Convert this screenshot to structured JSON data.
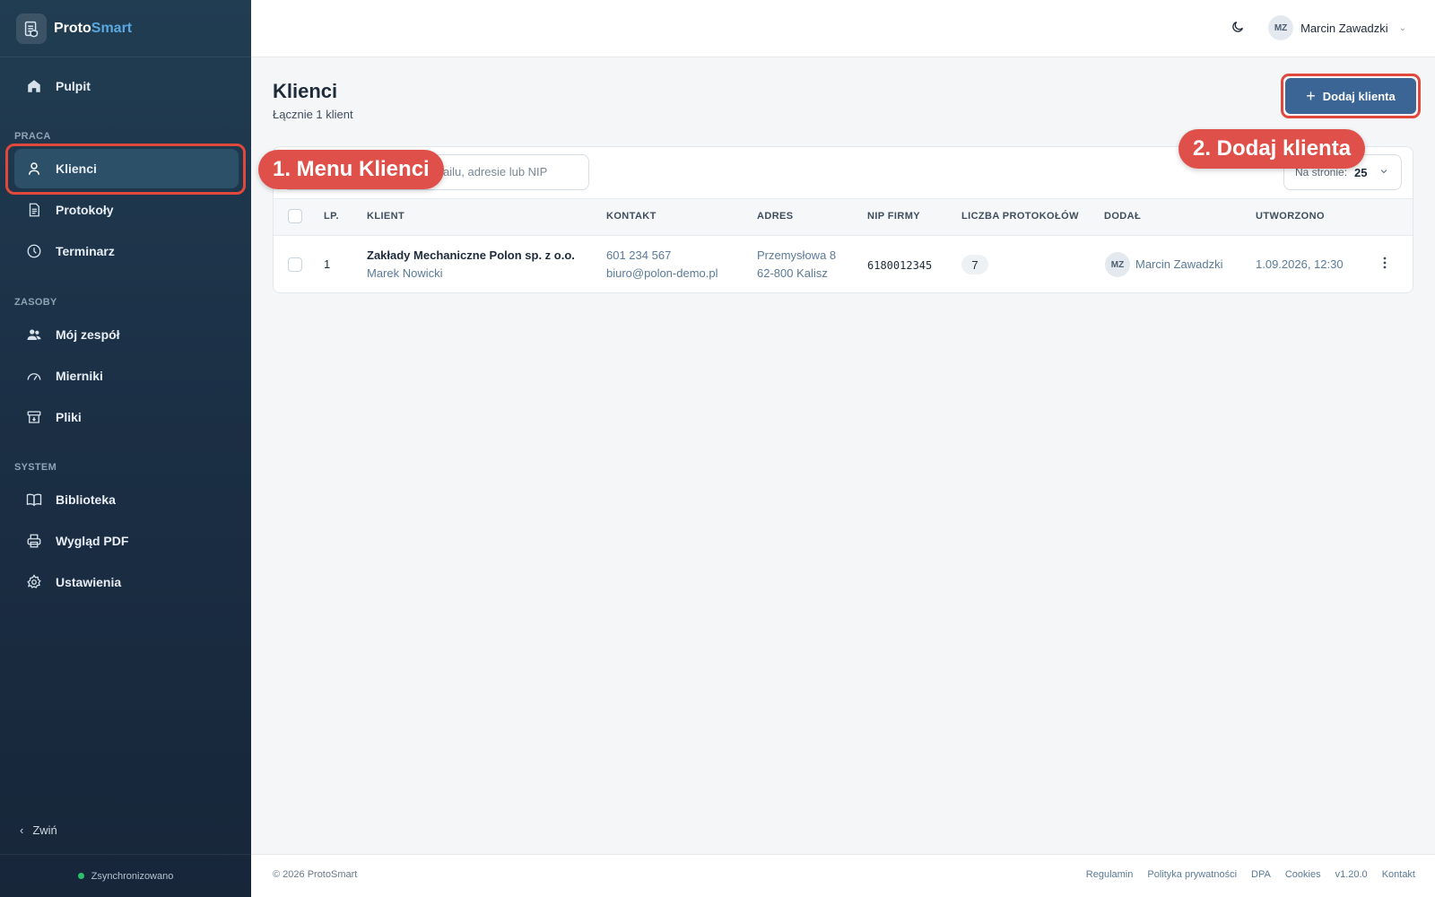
{
  "brand": {
    "name_a": "Proto",
    "name_b": "Smart"
  },
  "sidebar": {
    "dashboard": "Pulpit",
    "section_work": "PRACA",
    "clients": "Klienci",
    "protocols": "Protokoły",
    "schedule": "Terminarz",
    "section_resources": "ZASOBY",
    "team": "Mój zespół",
    "meters": "Mierniki",
    "files": "Pliki",
    "section_system": "SYSTEM",
    "library": "Biblioteka",
    "pdf_look": "Wygląd PDF",
    "settings": "Ustawienia",
    "collapse": "Zwiń",
    "sync_status": "Zsynchronizowano"
  },
  "topbar": {
    "user_initials": "MZ",
    "user_name": "Marcin Zawadzki"
  },
  "page": {
    "title": "Klienci",
    "subtitle": "Łącznie 1 klient",
    "add_button": "Dodaj klienta"
  },
  "search": {
    "visible_text": "ailu, adresie lub NIP"
  },
  "per_page": {
    "label": "Na stronie:",
    "value": "25"
  },
  "table": {
    "headers": {
      "lp": "LP.",
      "client": "KLIENT",
      "contact": "KONTAKT",
      "address": "ADRES",
      "nip": "NIP FIRMY",
      "count": "LICZBA PROTOKOŁÓW",
      "added_by": "DODAŁ",
      "created": "UTWORZONO"
    },
    "rows": [
      {
        "lp": "1",
        "company": "Zakłady Mechaniczne Polon sp. z o.o.",
        "person": "Marek Nowicki",
        "phone": "601 234 567",
        "email": "biuro@polon-demo.pl",
        "street": "Przemysłowa 8",
        "city": "62-800 Kalisz",
        "nip": "6180012345",
        "protocols": "7",
        "added_initials": "MZ",
        "added_by": "Marcin Zawadzki",
        "created": "1.09.2026, 12:30"
      }
    ]
  },
  "annotations": {
    "step1": "1. Menu Klienci",
    "step2": "2. Dodaj klienta"
  },
  "footer": {
    "copyright": "© 2026 ProtoSmart",
    "links": [
      "Regulamin",
      "Polityka prywatności",
      "DPA",
      "Cookies",
      "v1.20.0",
      "Kontakt"
    ]
  },
  "colors": {
    "sidebar": "#1b2f45",
    "primary_button": "#3a6595",
    "annotation": "#e0483c",
    "sync_ok": "#2bc06a"
  }
}
